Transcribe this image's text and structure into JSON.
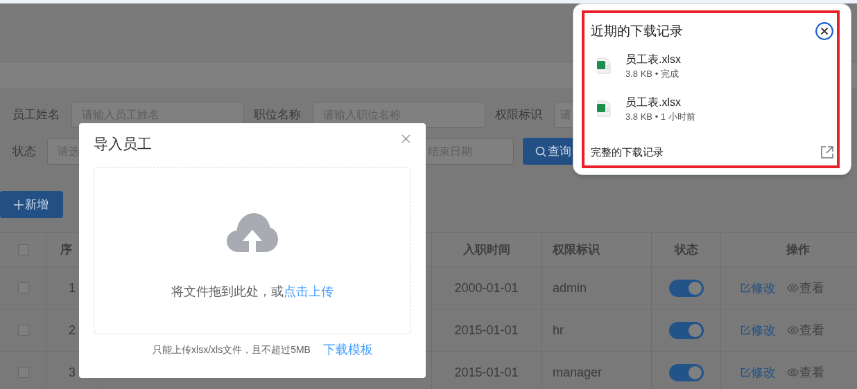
{
  "search_form": {
    "row1": [
      {
        "label": "员工姓名",
        "placeholder": "请输入员工姓名"
      },
      {
        "label": "职位名称",
        "placeholder": "请输入职位名称"
      },
      {
        "label": "权限标识",
        "placeholder": "请"
      }
    ],
    "status": {
      "label": "状态",
      "placeholder": "请选"
    },
    "date_end_placeholder": "结束日期",
    "search_button": "查询"
  },
  "add_button": "新增",
  "table": {
    "header_checked": false,
    "columns": [
      "序",
      "入职时间",
      "权限标识",
      "状态",
      "操作"
    ],
    "rows": [
      {
        "checked": false,
        "index": "1",
        "hire_date": "2000-01-01",
        "role": "admin",
        "enabled": true,
        "actions": [
          "修改",
          "查看"
        ]
      },
      {
        "checked": false,
        "index": "2",
        "hire_date": "2015-01-01",
        "role": "hr",
        "enabled": true,
        "actions": [
          "修改",
          "查看"
        ]
      },
      {
        "checked": false,
        "index": "3",
        "hire_date": "2015-01-01",
        "role": "manager",
        "enabled": true,
        "actions": [
          "修改",
          "查看"
        ]
      }
    ]
  },
  "import_dialog": {
    "title": "导入员工",
    "drop_text": "将文件拖到此处，或",
    "drop_link": "点击上传",
    "hint": "只能上传xlsx/xls文件，且不超过5MB",
    "template_link": "下载模板"
  },
  "downloads_popup": {
    "title": "近期的下载记录",
    "items": [
      {
        "name": "员工表.xlsx",
        "meta": "3.8 KB • 完成"
      },
      {
        "name": "员工表.xlsx",
        "meta": "3.8 KB • 1 小时前"
      }
    ],
    "footer": "完整的下载记录"
  }
}
